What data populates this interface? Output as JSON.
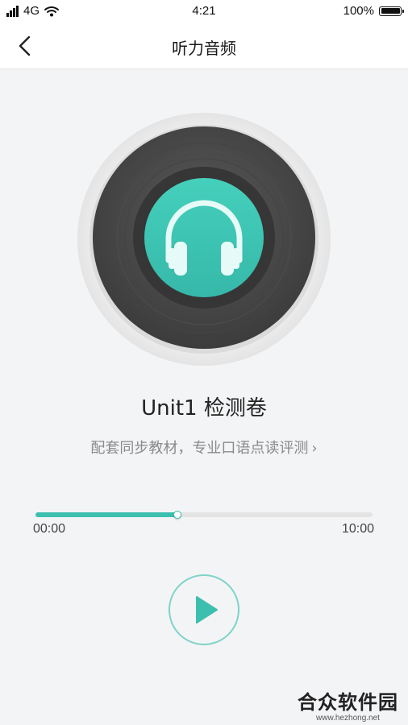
{
  "status_bar": {
    "network": "4G",
    "time": "4:21",
    "battery": "100%",
    "battery_level": 1.0
  },
  "nav": {
    "title": "听力音频",
    "back_icon": "chevron-left-icon"
  },
  "disc": {
    "icon": "headphones-icon",
    "accent_color": "#3dbfb0"
  },
  "track": {
    "title": "Unit1 检测卷",
    "subtitle": "配套同步教材，专业口语点读评测",
    "subtitle_chevron": "›"
  },
  "player": {
    "current_time": "00:00",
    "total_time": "10:00",
    "progress": 0.42,
    "play_icon": "play-icon"
  },
  "watermark": {
    "title": "合众软件园",
    "url": "www.hezhong.net"
  }
}
